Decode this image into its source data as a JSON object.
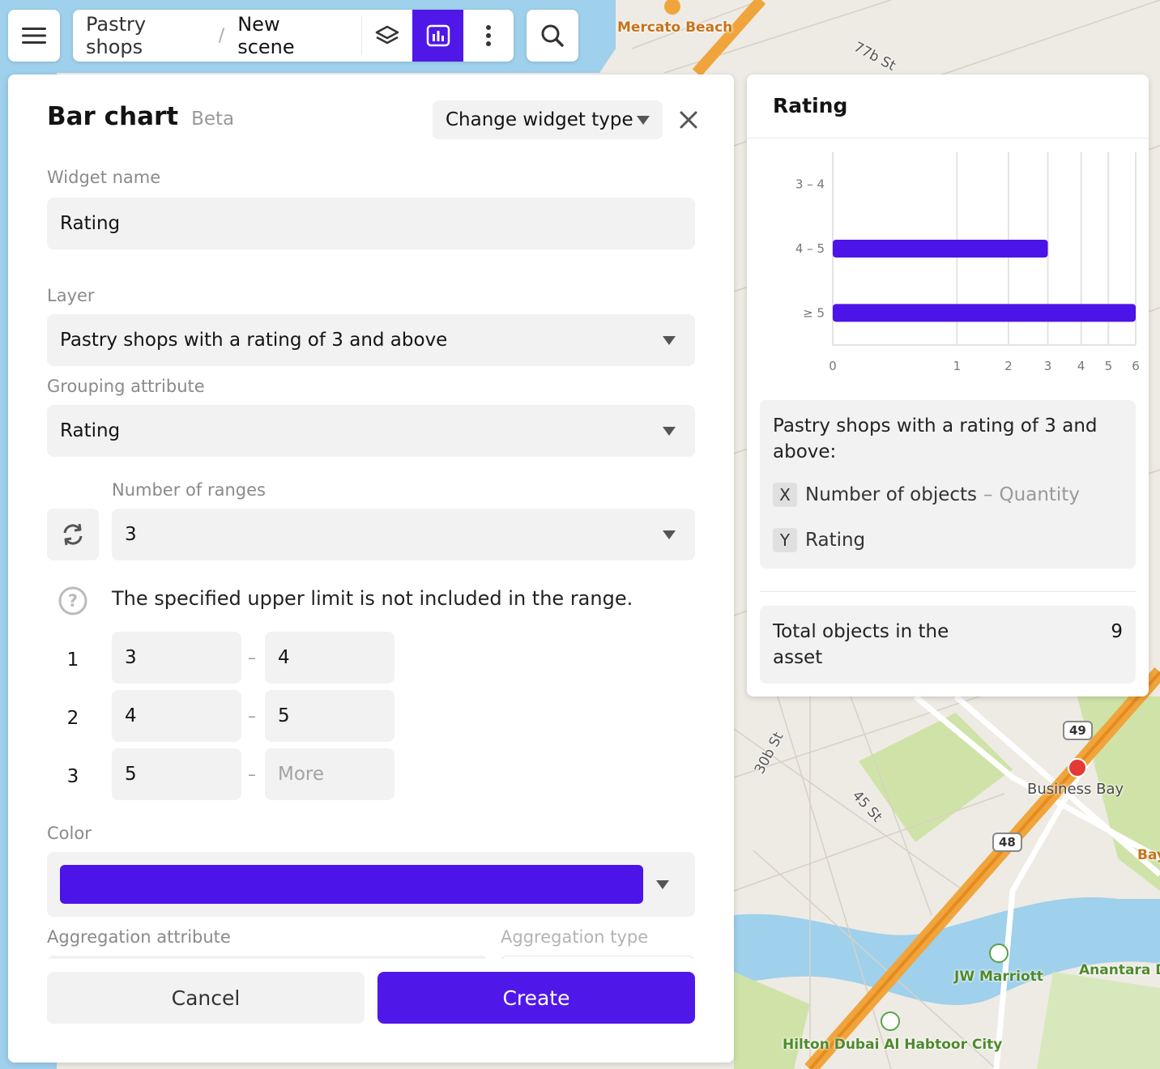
{
  "map": {
    "place_labels": [
      "Mercato Beach",
      "Business Bay",
      "JW Marriott",
      "Anantara D",
      "Hilton Dubai Al Habtoor City",
      "Bay"
    ],
    "street_labels": [
      "77b St",
      "30b St",
      "45 St"
    ],
    "route_shields": [
      "49",
      "48"
    ]
  },
  "toolbar": {
    "menu_icon": "hamburger-icon",
    "breadcrumb_parent": "Pastry shops",
    "breadcrumb_separator": "/",
    "breadcrumb_current": "New scene",
    "layers_icon": "layers-icon",
    "widgets_icon": "bar-chart-icon",
    "more_icon": "more-vertical-icon",
    "search_icon": "search-icon",
    "accent": "#5018e8"
  },
  "editor": {
    "title": "Bar chart",
    "badge": "Beta",
    "change_type_label": "Change widget type",
    "close_icon": "close-icon",
    "widget_name_label": "Widget name",
    "widget_name_value": "Rating",
    "layer_label": "Layer",
    "layer_value": "Pastry shops with a rating of 3 and above",
    "grouping_label": "Grouping attribute",
    "grouping_value": "Rating",
    "ranges_label": "Number of ranges",
    "ranges_value": "3",
    "reset_icon": "refresh-icon",
    "help_icon": "question-icon",
    "hint": "The specified upper limit is not included in the range.",
    "ranges": [
      {
        "num": "1",
        "from": "3",
        "to": "4"
      },
      {
        "num": "2",
        "from": "4",
        "to": "5"
      },
      {
        "num": "3",
        "from": "5",
        "to": "",
        "to_placeholder": "More"
      }
    ],
    "range_dash": "–",
    "color_label": "Color",
    "color_value": "#4c14e8",
    "aggregation_attr_label": "Aggregation attribute",
    "aggregation_type_label": "Aggregation type",
    "cancel_label": "Cancel",
    "create_label": "Create"
  },
  "widget": {
    "title": "Rating",
    "layer_name": "Pastry shops with a rating of 3 and above:",
    "x_tag": "X",
    "x_label": "Number of objects",
    "x_sep": "–",
    "x_aggregation": "Quantity",
    "y_tag": "Y",
    "y_label": "Rating",
    "total_label": "Total objects in the asset",
    "total_value": "9"
  },
  "chart_data": {
    "type": "bar",
    "orientation": "horizontal",
    "categories": [
      "3 – 4",
      "4 – 5",
      "≥ 5"
    ],
    "values": [
      0,
      3,
      6
    ],
    "xticks": [
      "0",
      "1",
      "2",
      "3",
      "4",
      "5",
      "6"
    ],
    "xlim": [
      0,
      6
    ],
    "xscale": "log-like (ticks compressed toward right)",
    "color": "#4c14e8",
    "grid": true
  }
}
